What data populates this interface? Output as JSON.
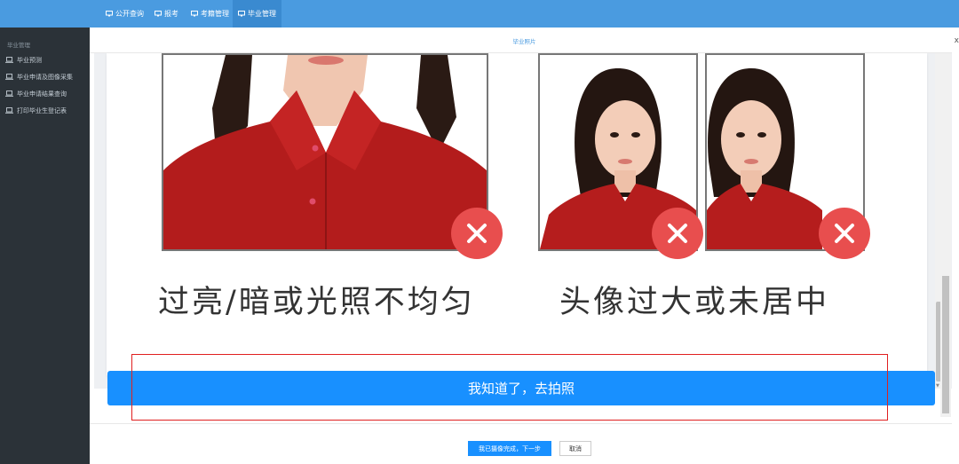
{
  "nav": {
    "items": [
      {
        "label": "公开查询",
        "icon": "monitor-icon"
      },
      {
        "label": "报考",
        "icon": "monitor-icon"
      },
      {
        "label": "考籍管理",
        "icon": "monitor-icon"
      },
      {
        "label": "毕业管理",
        "icon": "monitor-icon",
        "active": true
      }
    ]
  },
  "sidebar": {
    "heading": "毕业管理",
    "items": [
      {
        "label": "毕业预测",
        "icon": "laptop-icon"
      },
      {
        "label": "毕业申请及图像采集",
        "icon": "laptop-icon"
      },
      {
        "label": "毕业申请结果查询",
        "icon": "laptop-icon"
      },
      {
        "label": "打印毕业生登记表",
        "icon": "laptop-icon"
      }
    ]
  },
  "dialog": {
    "title": "毕业照片",
    "close": "x"
  },
  "examples": {
    "left_caption": "过亮/暗或光照不均匀",
    "right_caption": "头像过大或未居中"
  },
  "cta_label": "我知道了，去拍照",
  "buttons": {
    "confirm": "我已摄像完成，下一步",
    "cancel": "取消"
  },
  "colors": {
    "nav": "#4a9be0",
    "sidebar": "#2b3238",
    "primary": "#1890ff",
    "error": "#e84e4e",
    "highlight": "#e02020"
  }
}
